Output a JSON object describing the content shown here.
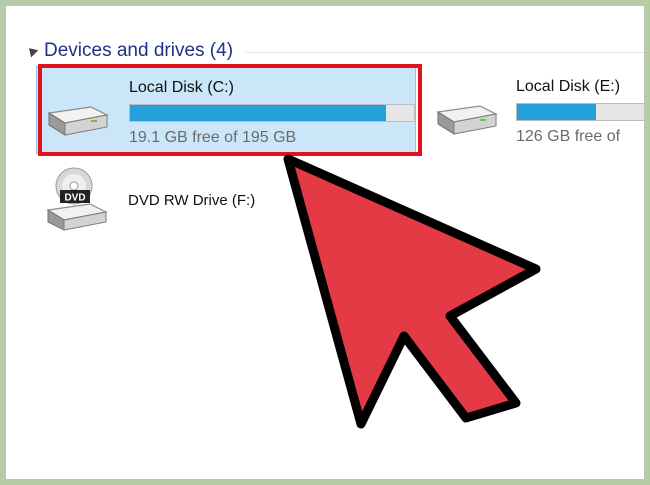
{
  "group": {
    "title": "Devices and drives (4)"
  },
  "drives": [
    {
      "name": "Local Disk (C:)",
      "free_text": "19.1 GB free of 195 GB",
      "used_fraction": 0.902,
      "icon": "hard-drive-icon",
      "selected": true
    },
    {
      "name": "Local Disk (E:)",
      "free_text": "126 GB free of",
      "used_fraction": 0.4,
      "icon": "hard-drive-icon",
      "selected": false
    },
    {
      "name": "DVD RW Drive (F:)",
      "icon": "dvd-drive-icon",
      "icon_label": "DVD",
      "selected": false
    }
  ],
  "colors": {
    "frame": "#b6cca6",
    "header_text": "#1e3287",
    "selection_bg": "#cbe6f8",
    "highlight_border": "#e0121d",
    "bar_fill": "#26a0da",
    "arrow_fill": "#e43a45",
    "arrow_outline": "#000000"
  }
}
